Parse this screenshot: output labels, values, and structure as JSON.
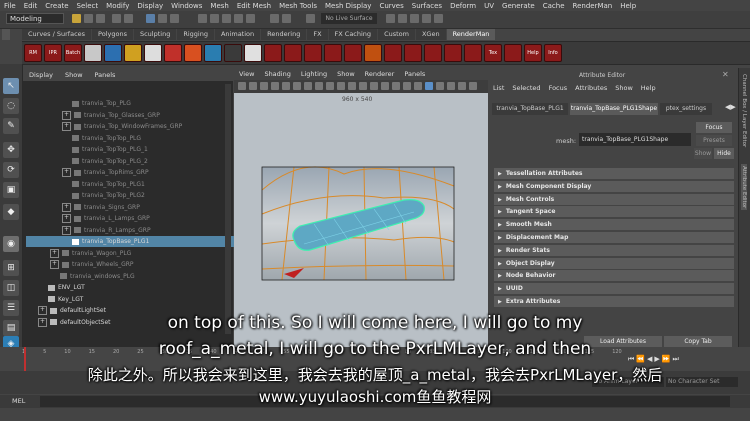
{
  "menubar": [
    "File",
    "Edit",
    "Create",
    "Select",
    "Modify",
    "Display",
    "Windows",
    "Mesh",
    "Edit Mesh",
    "Mesh Tools",
    "Mesh Display",
    "Curves",
    "Surfaces",
    "Deform",
    "UV",
    "Generate",
    "Cache",
    "RenderMan",
    "Help"
  ],
  "status": {
    "mode": "Modeling",
    "no_live_surface": "No Live Surface"
  },
  "shelf_tabs": [
    "Curves / Surfaces",
    "Polygons",
    "Sculpting",
    "Rigging",
    "Animation",
    "Rendering",
    "FX",
    "FX Caching",
    "Custom",
    "XGen",
    "RenderMan"
  ],
  "shelf_active": "RenderMan",
  "shelf_icons": [
    "RM",
    "IPR",
    "Batch",
    "",
    "",
    "",
    "",
    "",
    "",
    "",
    "",
    "",
    "",
    "",
    "",
    "",
    "",
    "",
    "",
    "",
    "",
    "",
    "",
    "Tex",
    "",
    "Help",
    "Info"
  ],
  "outliner": {
    "menu": [
      "Display",
      "Show",
      "Panels"
    ],
    "rows": [
      {
        "label": "tranvia_Top_PLG",
        "level": 2,
        "box": "",
        "bright": false
      },
      {
        "label": "tranvia_Top_Glasses_GRP",
        "level": 2,
        "box": "+",
        "bright": false
      },
      {
        "label": "tranvia_Top_WindowFrames_GRP",
        "level": 2,
        "box": "+",
        "bright": false
      },
      {
        "label": "tranvia_TopTop_PLG",
        "level": 2,
        "box": "",
        "bright": false
      },
      {
        "label": "tranvia_TopTop_PLG_1",
        "level": 2,
        "box": "",
        "bright": false
      },
      {
        "label": "tranvia_TopTop_PLG_2",
        "level": 2,
        "box": "",
        "bright": false
      },
      {
        "label": "tranvia_TopRims_GRP",
        "level": 2,
        "box": "+",
        "bright": false
      },
      {
        "label": "tranvia_TopTop_PLG1",
        "level": 2,
        "box": "",
        "bright": false
      },
      {
        "label": "tranvia_TopTop_PLG2",
        "level": 2,
        "box": "",
        "bright": false
      },
      {
        "label": "tranvia_Signs_GRP",
        "level": 2,
        "box": "+",
        "bright": false
      },
      {
        "label": "tranvia_L_Lamps_GRP",
        "level": 2,
        "box": "+",
        "bright": false
      },
      {
        "label": "tranvia_R_Lamps_GRP",
        "level": 2,
        "box": "+",
        "bright": false
      },
      {
        "label": "tranvia_TopBase_PLG1",
        "level": 2,
        "box": "",
        "bright": true,
        "selected": true
      },
      {
        "label": "tranvia_Wagon_PLG",
        "level": 1,
        "box": "+",
        "bright": false
      },
      {
        "label": "tranvia_Wheels_GRP",
        "level": 1,
        "box": "+",
        "bright": false
      },
      {
        "label": "tranvia_windows_PLG",
        "level": 1,
        "box": "",
        "bright": false
      },
      {
        "label": "ENV_LGT",
        "level": 0,
        "box": "",
        "bright": true
      },
      {
        "label": "Key_LGT",
        "level": 0,
        "box": "",
        "bright": true
      },
      {
        "label": "defaultLightSet",
        "level": 0,
        "box": "+",
        "bright": true
      },
      {
        "label": "defaultObjectSet",
        "level": 0,
        "box": "+",
        "bright": true
      }
    ]
  },
  "viewport": {
    "menu": [
      "View",
      "Shading",
      "Lighting",
      "Show",
      "Renderer",
      "Panels"
    ],
    "resolution": "960 x 540"
  },
  "attr_editor": {
    "title": "Attribute Editor",
    "menu": [
      "List",
      "Selected",
      "Focus",
      "Attributes",
      "Show",
      "Help"
    ],
    "tabs": [
      "tranvia_TopBase_PLG1",
      "tranvia_TopBase_PLG1Shape",
      "ptex_settings"
    ],
    "active_tab": "tranvia_TopBase_PLG1Shape",
    "field_label": "mesh:",
    "field_value": "tranvia_TopBase_PLG1Shape",
    "buttons": {
      "focus": "Focus",
      "presets": "Presets",
      "show": "Show",
      "hide": "Hide"
    },
    "sections": [
      "Tessellation Attributes",
      "Mesh Component Display",
      "Mesh Controls",
      "Tangent Space",
      "Smooth Mesh",
      "Displacement Map",
      "Render Stats",
      "Object Display",
      "Node Behavior",
      "UUID",
      "Extra Attributes"
    ],
    "bottom_buttons": {
      "load": "Load Attributes",
      "copy": "Copy Tab"
    }
  },
  "right_strip": [
    "Channel Box / Layer Editor",
    "Attribute Editor"
  ],
  "timeline": {
    "ticks": [
      "1",
      "5",
      "10",
      "15",
      "20",
      "25",
      "30",
      "35",
      "40",
      "45",
      "50",
      "55",
      "60",
      "65",
      "70",
      "75",
      "80",
      "85",
      "90",
      "95",
      "100",
      "105",
      "110",
      "115",
      "120"
    ],
    "no_anim_layer": "No Anim Layer",
    "no_char_set": "No Character Set",
    "current": "1"
  },
  "cmdline": {
    "label": "MEL"
  },
  "subtitles": {
    "line1": "on top of this. So I will come here, I will go to my",
    "line2": "roof_a_metal, I will go to the PxrLMLayer, and then",
    "line3": "除此之外。所以我会来到这里，我会去我的屋顶_a_metal，我会去PxrLMLayer，然后",
    "line4": "www.yuyulaoshi.com鱼鱼教程网"
  }
}
